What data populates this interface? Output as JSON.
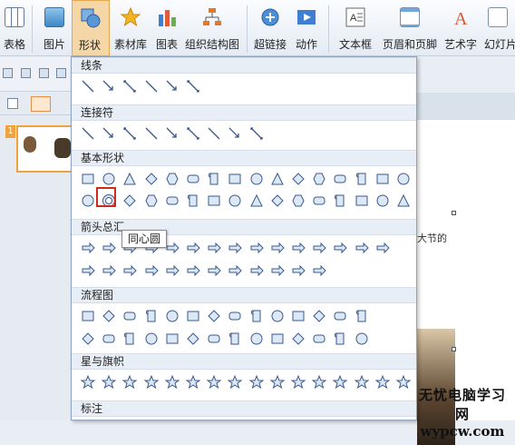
{
  "ribbon": {
    "items": [
      {
        "label": "表格",
        "icon": "table-icon"
      },
      {
        "label": "图片",
        "icon": "picture-icon"
      },
      {
        "label": "形状",
        "icon": "shapes-icon",
        "active": true
      },
      {
        "label": "素材库",
        "icon": "star-icon"
      },
      {
        "label": "图表",
        "icon": "chart-icon"
      },
      {
        "label": "组织结构图",
        "icon": "org-chart-icon"
      },
      {
        "label": "超链接",
        "icon": "hyperlink-icon"
      },
      {
        "label": "动作",
        "icon": "action-icon"
      },
      {
        "label": "文本框",
        "icon": "textbox-icon"
      },
      {
        "label": "页眉和页脚",
        "icon": "header-footer-icon"
      },
      {
        "label": "艺术字",
        "icon": "wordart-icon"
      },
      {
        "label": "幻灯片",
        "icon": "slide-icon"
      }
    ]
  },
  "thumbnail": {
    "number": "1"
  },
  "menu": {
    "sections": [
      {
        "title": "线条",
        "count": 6
      },
      {
        "title": "连接符",
        "count": 9
      },
      {
        "title": "基本形状",
        "count": 32
      },
      {
        "title": "箭头总汇",
        "count": 27
      },
      {
        "title": "流程图",
        "count": 28
      },
      {
        "title": "星与旗帜",
        "count": 16
      },
      {
        "title": "标注",
        "count": 0
      }
    ],
    "tooltip": "同心圆"
  },
  "slide": {
    "caption": "大节的"
  },
  "watermark": {
    "line1": "无忧电脑学习网",
    "line2": "wypcw.com"
  },
  "colors": {
    "accent": "#e1a850",
    "shape_stroke": "#3a5a8c",
    "shape_fill": "#dce8f6",
    "highlight": "#d12a1a"
  }
}
